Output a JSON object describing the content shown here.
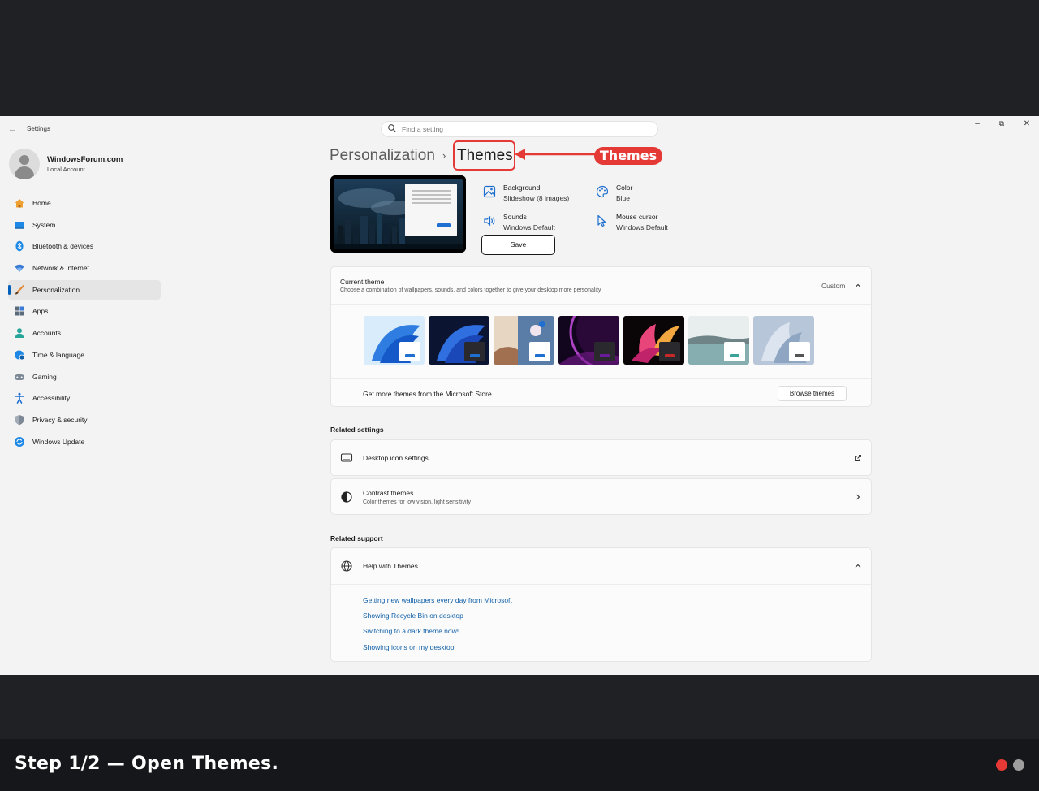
{
  "window": {
    "app_title": "Settings",
    "search_placeholder": "Find a setting"
  },
  "profile": {
    "name": "WindowsForum.com",
    "account_type": "Local Account"
  },
  "nav": {
    "items": [
      {
        "label": "Home",
        "icon": "home-icon",
        "color": "#f0a030"
      },
      {
        "label": "System",
        "icon": "system-icon",
        "color": "#1e88e5"
      },
      {
        "label": "Bluetooth & devices",
        "icon": "bluetooth-icon",
        "color": "#1e88e5"
      },
      {
        "label": "Network & internet",
        "icon": "network-icon",
        "color": "#3a7bd5"
      },
      {
        "label": "Personalization",
        "icon": "brush-icon",
        "color": "#e08a3a",
        "selected": true
      },
      {
        "label": "Apps",
        "icon": "apps-icon",
        "color": "#5c6b7a"
      },
      {
        "label": "Accounts",
        "icon": "accounts-icon",
        "color": "#26a69a"
      },
      {
        "label": "Time & language",
        "icon": "globe-clock-icon",
        "color": "#1e88e5"
      },
      {
        "label": "Gaming",
        "icon": "gamepad-icon",
        "color": "#7d8896"
      },
      {
        "label": "Accessibility",
        "icon": "accessibility-icon",
        "color": "#1e6fd0"
      },
      {
        "label": "Privacy & security",
        "icon": "shield-icon",
        "color": "#7d8896"
      },
      {
        "label": "Windows Update",
        "icon": "update-icon",
        "color": "#1e88e5"
      }
    ]
  },
  "breadcrumb": {
    "parent": "Personalization",
    "separator": "›",
    "current": "Themes"
  },
  "annotation": {
    "label": "Themes",
    "color": "#e53935"
  },
  "theme_props": {
    "background": {
      "title": "Background",
      "value": "Slideshow (8 images)"
    },
    "color": {
      "title": "Color",
      "value": "Blue"
    },
    "sounds": {
      "title": "Sounds",
      "value": "Windows Default"
    },
    "cursor": {
      "title": "Mouse cursor",
      "value": "Windows Default"
    },
    "save_label": "Save"
  },
  "current_theme": {
    "title": "Current theme",
    "subtitle": "Choose a combination of wallpapers, sounds, and colors together to give your desktop more personality",
    "state": "Custom",
    "store_text": "Get more themes from the Microsoft Store",
    "browse_label": "Browse themes",
    "themes": [
      {
        "name": "windows-light",
        "accent": "#1e6fd0"
      },
      {
        "name": "windows-dark",
        "accent": "#1e6fd0"
      },
      {
        "name": "windows-spotlight",
        "accent": "#1e6fd0"
      },
      {
        "name": "glow",
        "accent": "#6a1b9a"
      },
      {
        "name": "captured-motion",
        "accent": "#c62828"
      },
      {
        "name": "sunrise",
        "accent": "#3ba39a"
      },
      {
        "name": "flow",
        "accent": "#555555"
      }
    ]
  },
  "related_settings": {
    "heading": "Related settings",
    "desktop_icons": "Desktop icon settings",
    "contrast_title": "Contrast themes",
    "contrast_sub": "Color themes for low vision, light sensitivity"
  },
  "related_support": {
    "heading": "Related support",
    "help_title": "Help with Themes",
    "links": [
      "Getting new wallpapers every day from Microsoft",
      "Showing Recycle Bin on desktop",
      "Switching to a dark theme now!",
      "Showing icons on my desktop"
    ]
  },
  "caption": {
    "text": "Step 1/2 — Open Themes."
  }
}
